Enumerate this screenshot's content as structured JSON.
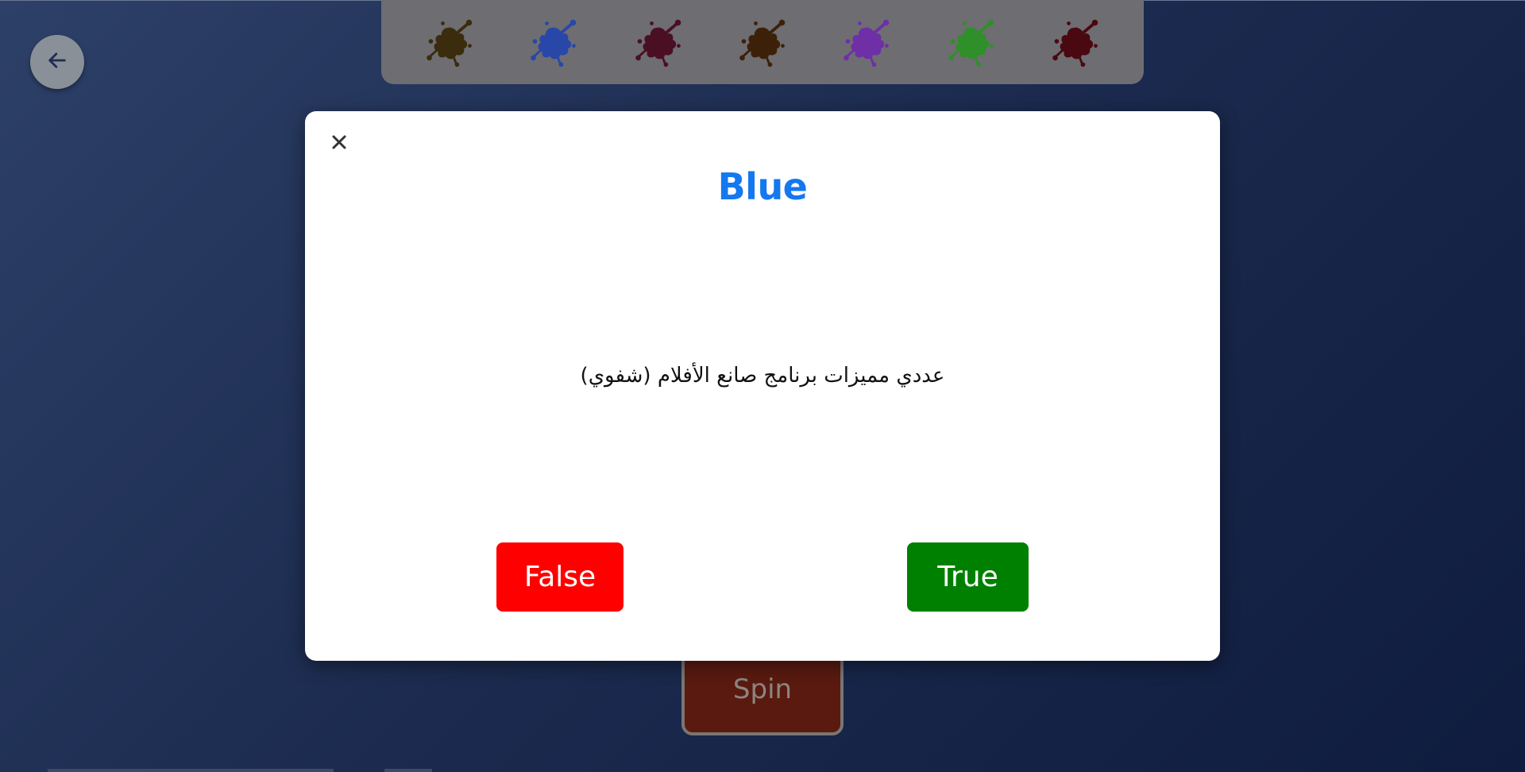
{
  "colors": {
    "title": "#1478f0",
    "false_button": "#ff0000",
    "true_button": "#008000"
  },
  "splats": [
    {
      "icon": "paint-splat-icon",
      "color": "#3a2c0c"
    },
    {
      "icon": "paint-splat-icon",
      "color": "#2847a8"
    },
    {
      "icon": "paint-splat-icon",
      "color": "#4a0f22"
    },
    {
      "icon": "paint-splat-icon",
      "color": "#3c2008"
    },
    {
      "icon": "paint-splat-icon",
      "color": "#6f2fa6"
    },
    {
      "icon": "paint-splat-icon",
      "color": "#2f8f28"
    },
    {
      "icon": "paint-splat-icon",
      "color": "#4a0810"
    }
  ],
  "modal": {
    "title": "Blue",
    "question": "عددي مميزات برنامج صانع الأفلام (شفوي)",
    "false_label": "False",
    "true_label": "True"
  },
  "spin_label": "Spin"
}
